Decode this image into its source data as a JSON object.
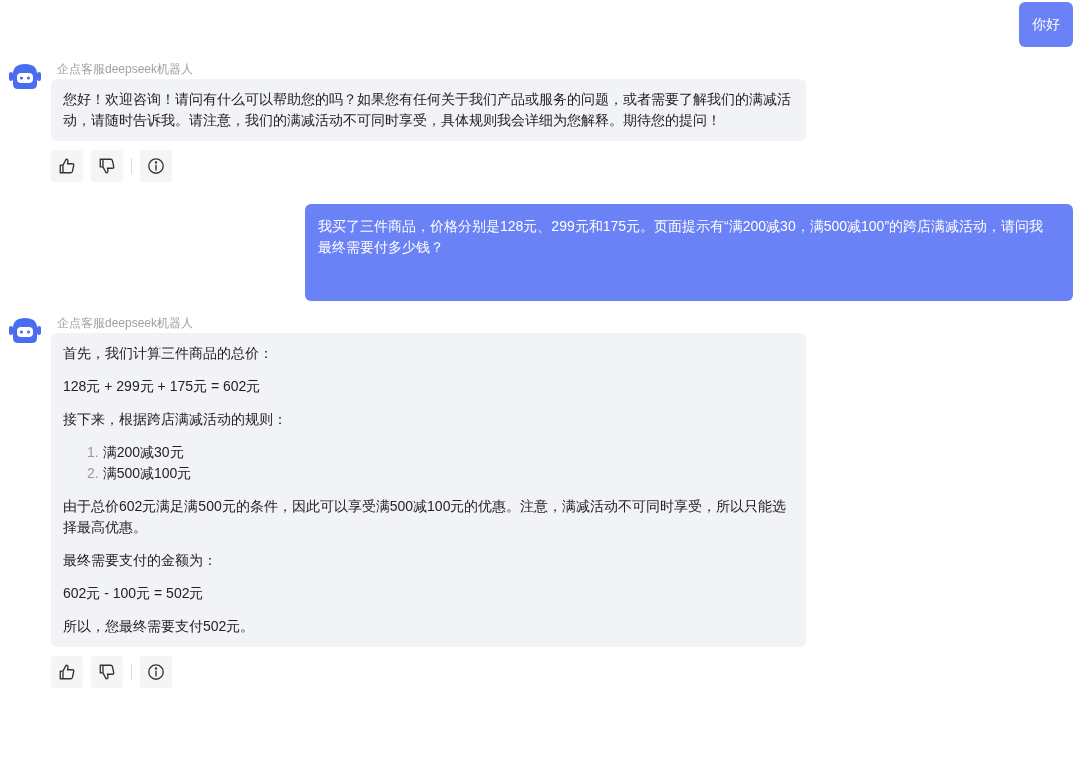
{
  "messages": [
    {
      "kind": "user",
      "text": "你好"
    },
    {
      "kind": "bot",
      "sender": "企点客服deepseek机器人",
      "blocks": [
        {
          "kind": "paragraph",
          "text": "您好！欢迎咨询！请问有什么可以帮助您的吗？如果您有任何关于我们产品或服务的问题，或者需要了解我们的满减活动，请随时告诉我。请注意，我们的满减活动不可同时享受，具体规则我会详细为您解释。期待您的提问！"
        }
      ]
    },
    {
      "kind": "user",
      "text": "我买了三件商品，价格分别是128元、299元和175元。页面提示有“满200减30，满500减100”的跨店满减活动，请问我最终需要付多少钱？"
    },
    {
      "kind": "bot",
      "sender": "企点客服deepseek机器人",
      "blocks": [
        {
          "kind": "paragraph",
          "text": "首先，我们计算三件商品的总价："
        },
        {
          "kind": "paragraph",
          "text": "128元 + 299元 + 175元 = 602元"
        },
        {
          "kind": "paragraph",
          "text": "接下来，根据跨店满减活动的规则："
        },
        {
          "kind": "list",
          "items": [
            {
              "number": "1.",
              "text": "满200减30元"
            },
            {
              "number": "2.",
              "text": "满500减100元"
            }
          ]
        },
        {
          "kind": "paragraph",
          "text": "由于总价602元满足满500元的条件，因此可以享受满500减100元的优惠。注意，满减活动不可同时享受，所以只能选择最高优惠。"
        },
        {
          "kind": "paragraph",
          "text": "最终需要支付的金额为："
        },
        {
          "kind": "paragraph",
          "text": "602元 - 100元 = 502元"
        },
        {
          "kind": "paragraph",
          "text": "所以，您最终需要支付502元。"
        }
      ]
    }
  ]
}
